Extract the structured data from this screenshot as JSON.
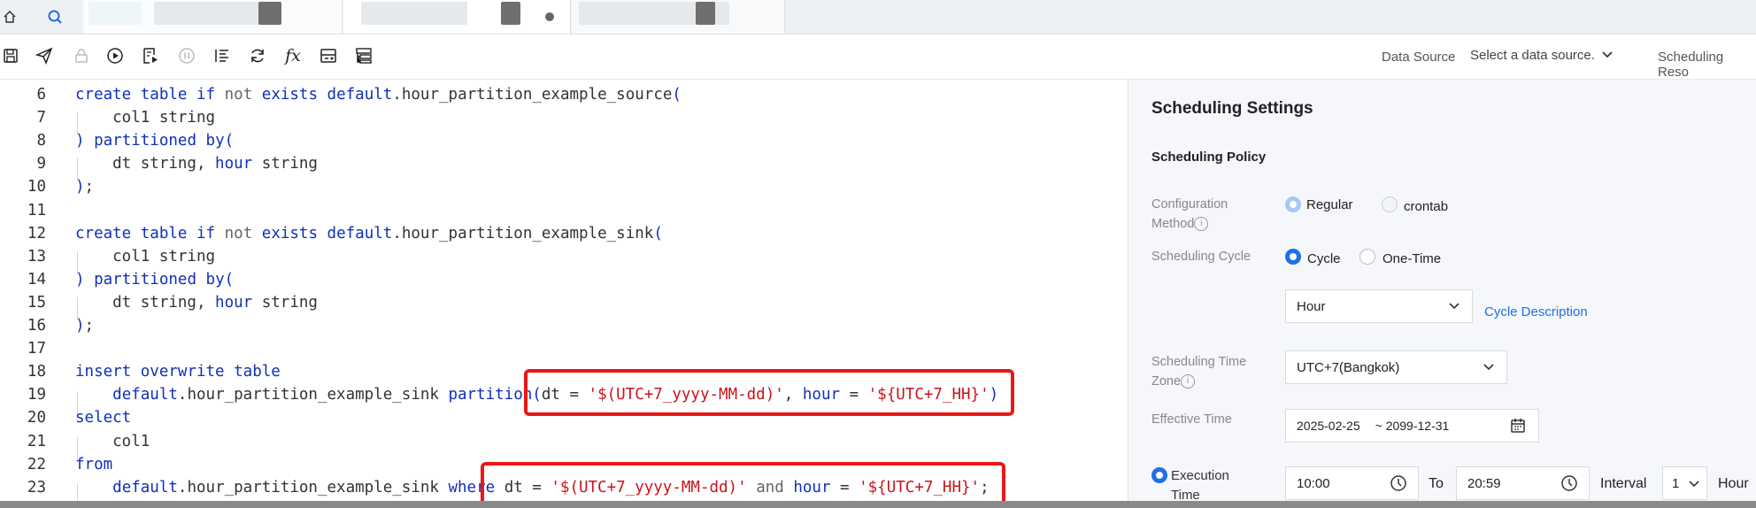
{
  "tabs": {
    "home_icon": "home-icon",
    "search_icon": "search-icon",
    "tab1_state": "active",
    "tab2_state": "unsaved",
    "tab3_state": "inactive"
  },
  "toolbar": {
    "icons": [
      "save-icon",
      "publish-icon",
      "lock-icon",
      "run-icon",
      "run-selected-icon",
      "stop-icon",
      "format-icon",
      "refresh-icon",
      "function-icon",
      "params-icon",
      "resources-icon"
    ],
    "fx_label": "fx",
    "data_source_label": "Data Source",
    "data_source_placeholder": "Select a data source.",
    "scheduling_resource_label": "Scheduling Reso"
  },
  "editor": {
    "lines": [
      {
        "n": "6",
        "t": "create table if not exists default.hour_partition_example_source("
      },
      {
        "n": "7",
        "t": "    col1 string"
      },
      {
        "n": "8",
        "t": ") partitioned by("
      },
      {
        "n": "9",
        "t": "    dt string, hour string"
      },
      {
        "n": "10",
        "t": ");"
      },
      {
        "n": "11",
        "t": ""
      },
      {
        "n": "12",
        "t": "create table if not exists default.hour_partition_example_sink("
      },
      {
        "n": "13",
        "t": "    col1 string"
      },
      {
        "n": "14",
        "t": ") partitioned by("
      },
      {
        "n": "15",
        "t": "    dt string, hour string"
      },
      {
        "n": "16",
        "t": ");"
      },
      {
        "n": "17",
        "t": ""
      },
      {
        "n": "18",
        "t": "insert overwrite table"
      },
      {
        "n": "19",
        "t": "    default.hour_partition_example_sink partition(dt = '$(UTC+7_yyyy-MM-dd)', hour = '${UTC+7_HH}')"
      },
      {
        "n": "20",
        "t": "select"
      },
      {
        "n": "21",
        "t": "    col1"
      },
      {
        "n": "22",
        "t": "from"
      },
      {
        "n": "23",
        "t": "    default.hour_partition_example_sink where dt = '$(UTC+7_yyyy-MM-dd)' and hour = '${UTC+7_HH}';"
      }
    ]
  },
  "panel": {
    "title": "Scheduling Settings",
    "policy_title": "Scheduling Policy",
    "config_method_label_1": "Configuration",
    "config_method_label_2": "Method",
    "config_method_options": [
      "Regular",
      "crontab"
    ],
    "cycle_label": "Scheduling Cycle",
    "cycle_options": [
      "Cycle",
      "One-Time"
    ],
    "cycle_unit": "Hour",
    "cycle_description_link": "Cycle Description",
    "timezone_label_1": "Scheduling Time",
    "timezone_label_2": "Zone",
    "timezone_value": "UTC+7(Bangkok)",
    "effective_label": "Effective Time",
    "effective_start": "2025-02-25",
    "effective_end": "~ 2099-12-31",
    "exec_label_1": "Execution",
    "exec_label_2": "Time",
    "exec_start": "10:00",
    "to_label": "To",
    "exec_end": "20:59",
    "interval_label": "Interval",
    "interval_value": "1",
    "interval_unit": "Hour"
  },
  "colors": {
    "accent": "#1f6fe8",
    "keyword": "#1030b8",
    "string": "#c8141a",
    "highlight_box": "#e81818"
  }
}
